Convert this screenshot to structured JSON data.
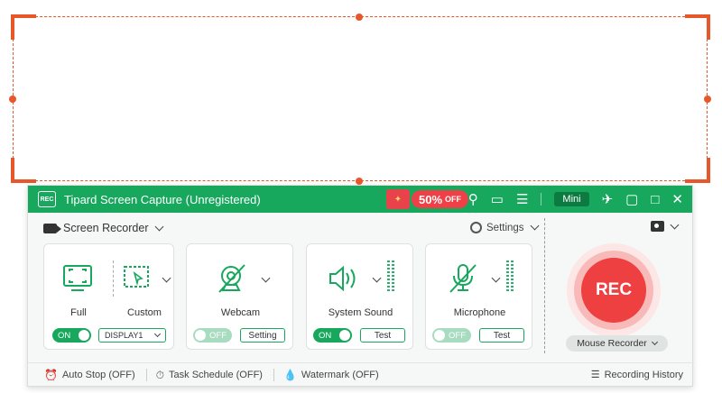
{
  "window": {
    "title": "Tipard Screen Capture (Unregistered)",
    "logo_text": "REC"
  },
  "promo": {
    "discount": "50%",
    "suffix": "OFF"
  },
  "titlebar": {
    "mini_label": "Mini"
  },
  "mode": {
    "label": "Screen Recorder"
  },
  "settings": {
    "label": "Settings"
  },
  "display": {
    "full_label": "Full",
    "custom_label": "Custom",
    "toggle": "ON",
    "select_value": "DISPLAY1"
  },
  "webcam": {
    "label": "Webcam",
    "toggle": "OFF",
    "button": "Setting"
  },
  "system_sound": {
    "label": "System Sound",
    "toggle": "ON",
    "button": "Test"
  },
  "microphone": {
    "label": "Microphone",
    "toggle": "OFF",
    "button": "Test"
  },
  "rec": {
    "label": "REC",
    "mode": "Mouse Recorder"
  },
  "bottom": {
    "auto_stop": "Auto Stop (OFF)",
    "task_schedule": "Task Schedule (OFF)",
    "watermark": "Watermark (OFF)",
    "history": "Recording History"
  },
  "colors": {
    "accent": "#17a85e",
    "rec": "#ee3f41",
    "region": "#e8572a"
  }
}
